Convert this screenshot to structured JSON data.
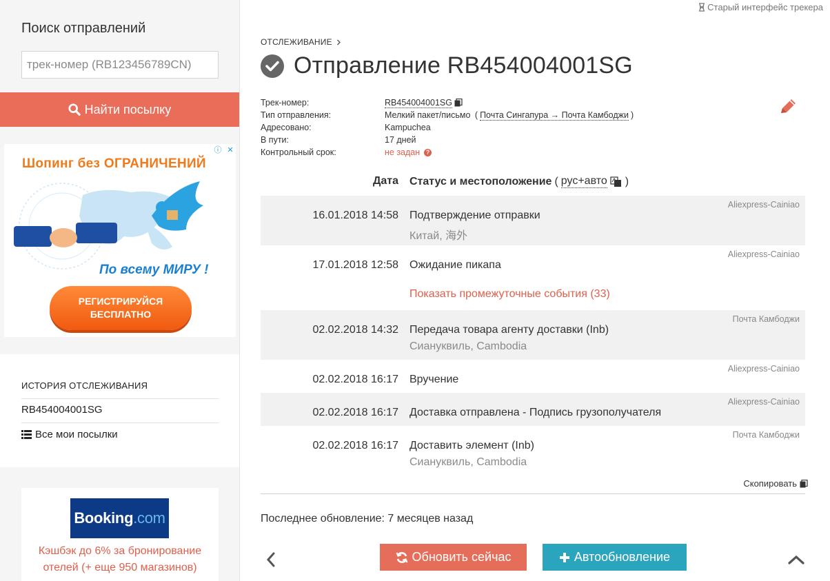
{
  "sidebar": {
    "search_title": "Поиск отправлений",
    "search_placeholder": "трек-номер (RB123456789CN)",
    "find_button_label": "Найти посылку",
    "ad": {
      "title_prefix": "Шопинг без ",
      "title_caps": "ОГРАНИЧЕНИЙ",
      "subtitle": "По всему МИРУ !",
      "button_line1": "РЕГИСТРИРУЙСЯ",
      "button_line2": "БЕСПЛАТНО"
    },
    "history": {
      "title": "ИСТОРИЯ ОТСЛЕЖИВАНИЯ",
      "items": [
        "RB454004001SG"
      ],
      "all_parcels_label": "Все мои посылки"
    },
    "booking": {
      "logo_main": "Booking",
      "logo_suffix": ".com",
      "text": "Кэшбэк до 6% за бронирование отелей (+ еще 950 магазинов)"
    }
  },
  "main": {
    "old_ui_link": "Старый интерфейс трекера",
    "breadcrumb": "ОТСЛЕЖИВАНИЕ",
    "title": "Отправление RB454004001SG",
    "info": {
      "track_label": "Трек-номер:",
      "track_value": "RB454004001SG",
      "type_label": "Тип отправления:",
      "type_value": "Мелкий пакет/письмо",
      "route": "Почта Сингапура → Почта Камбоджи",
      "addressee_label": "Адресовано:",
      "addressee_value": "Kampuchea",
      "transit_label": "В пути:",
      "transit_value": "17 дней",
      "deadline_label": "Контрольный срок:",
      "deadline_value": "не задан"
    },
    "table": {
      "date_header": "Дата",
      "status_header": "Статус и местоположение",
      "lang_label": "рус+авто"
    },
    "events": [
      {
        "date": "16.01.2018 14:58",
        "status": "Подтверждение отправки",
        "location": "Китай, 海外",
        "source": "Aliexpress-Cainiao"
      },
      {
        "date": "17.01.2018 12:58",
        "status": "Ожидание пикапа",
        "location": "",
        "source": "Aliexpress-Cainiao"
      },
      {
        "date": "02.02.2018 14:32",
        "status": "Передача товара агенту доставки (Inb)",
        "location": "Сиануквиль, Cambodia",
        "source": "Почта Камбоджи"
      },
      {
        "date": "02.02.2018 16:17",
        "status": "Вручение",
        "location": "",
        "source": "Aliexpress-Cainiao"
      },
      {
        "date": "02.02.2018 16:17",
        "status": "Доставка отправлена - Подпись грузополучателя",
        "location": "",
        "source": "Aliexpress-Cainiao"
      },
      {
        "date": "02.02.2018 16:17",
        "status": "Доставить элемент (Inb)",
        "location": "Сиануквиль, Cambodia",
        "source": "Почта Камбоджи"
      }
    ],
    "show_more_label": "Показать промежуточные события (33)",
    "copy_label": "Скопировать",
    "last_update": "Последнее обновление: 7 месяцев назад",
    "refresh_label": "Обновить сейчас",
    "auto_label": "Автообновление"
  },
  "colors": {
    "accent_red": "#ea6d5a",
    "accent_teal": "#2ba4bd",
    "booking_blue": "#0c3a86"
  }
}
